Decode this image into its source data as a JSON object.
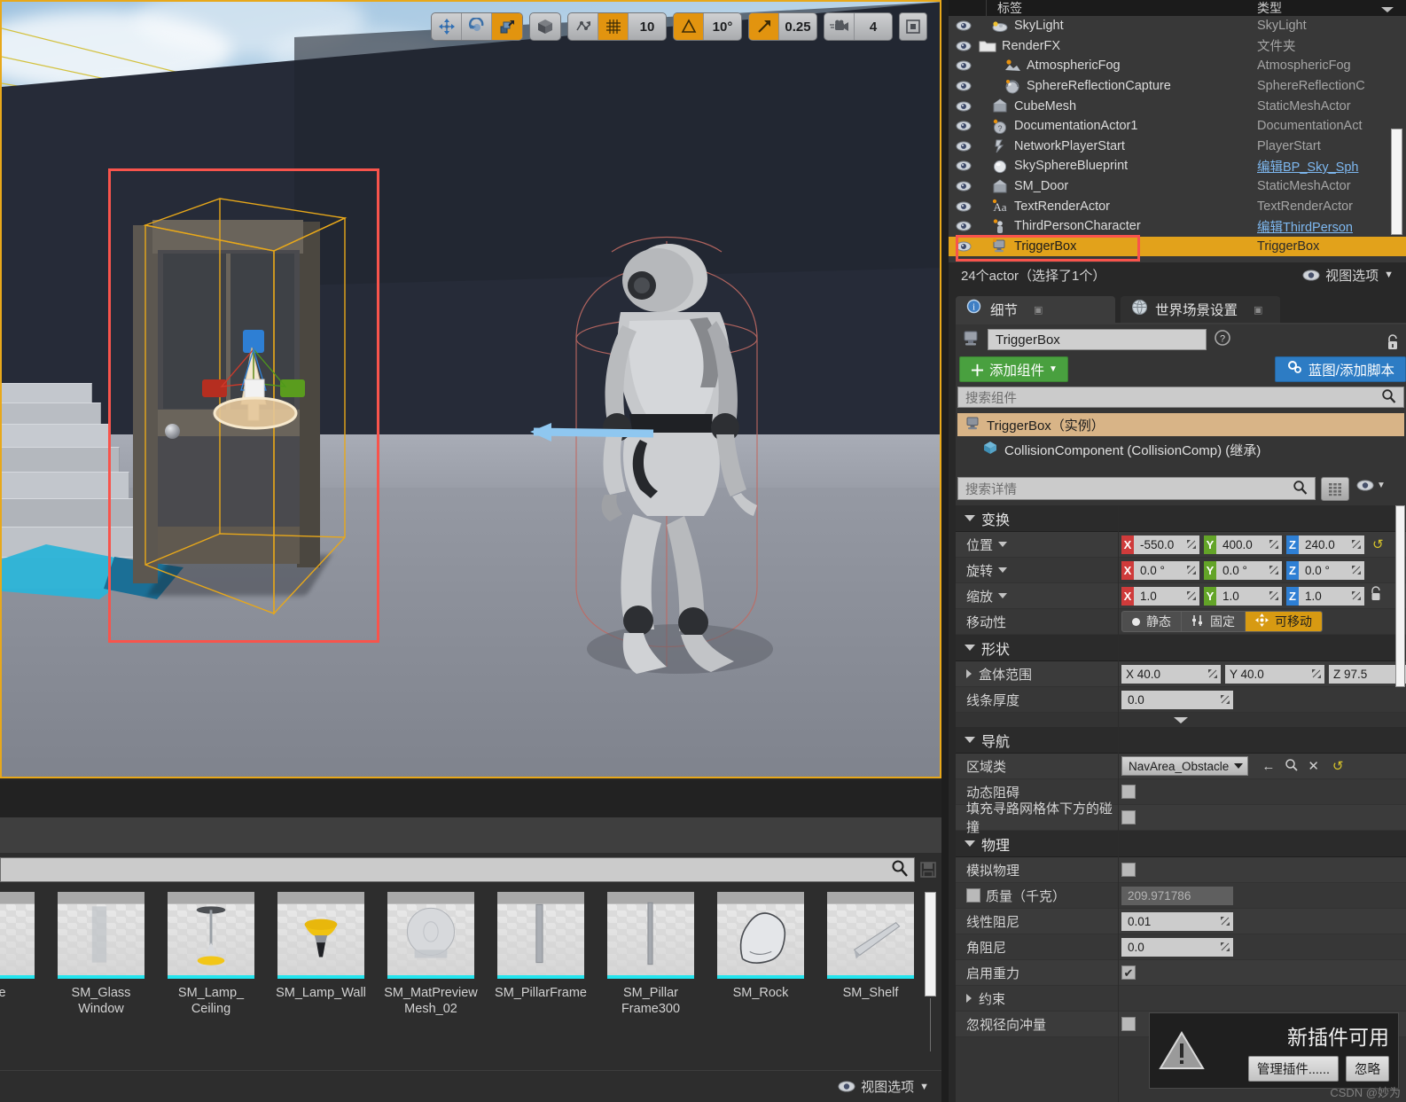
{
  "viewport": {
    "toolbar": {
      "transform_modes": [
        {
          "name": "translate-mode",
          "active": false
        },
        {
          "name": "rotate-mode",
          "active": false
        },
        {
          "name": "scale-mode",
          "active": true
        }
      ],
      "coord_space": {
        "name": "world-space-toggle",
        "active": false
      },
      "surface_snap": {
        "name": "surface-snap-toggle",
        "active": false
      },
      "grid_snap": {
        "name": "grid-snap-toggle",
        "active": true,
        "value": "10"
      },
      "angle_snap": {
        "name": "angle-snap-toggle",
        "active": true,
        "value": "10°"
      },
      "scale_snap": {
        "name": "scale-snap-toggle",
        "active": true,
        "value": "0.25"
      },
      "camera_speed": {
        "name": "camera-speed",
        "value": "4"
      },
      "maximize": {
        "name": "maximize-viewport-button"
      }
    }
  },
  "outliner": {
    "columns": {
      "label": "标签",
      "type": "类型"
    },
    "rows": [
      {
        "name": "SkyLight",
        "type": "SkyLight",
        "indent": 1,
        "icon": "skylight-icon",
        "blueprint": false,
        "selected": false
      },
      {
        "name": "RenderFX",
        "type": "文件夹",
        "indent": 0,
        "icon": "folder-icon",
        "blueprint": false,
        "selected": false
      },
      {
        "name": "AtmosphericFog",
        "type": "AtmosphericFog",
        "indent": 2,
        "icon": "fog-icon",
        "blueprint": false,
        "selected": false
      },
      {
        "name": "SphereReflectionCapture",
        "type": "SphereReflectionC",
        "indent": 2,
        "icon": "reflection-icon",
        "blueprint": false,
        "selected": false
      },
      {
        "name": "CubeMesh",
        "type": "StaticMeshActor",
        "indent": 1,
        "icon": "mesh-icon",
        "blueprint": false,
        "selected": false
      },
      {
        "name": "DocumentationActor1",
        "type": "DocumentationAct",
        "indent": 1,
        "icon": "doc-icon",
        "blueprint": false,
        "selected": false
      },
      {
        "name": "NetworkPlayerStart",
        "type": "PlayerStart",
        "indent": 1,
        "icon": "playerstart-icon",
        "blueprint": false,
        "selected": false
      },
      {
        "name": "SkySphereBlueprint",
        "type": "编辑BP_Sky_Sph",
        "indent": 1,
        "icon": "sphere-icon",
        "blueprint": true,
        "selected": false
      },
      {
        "name": "SM_Door",
        "type": "StaticMeshActor",
        "indent": 1,
        "icon": "mesh-icon",
        "blueprint": false,
        "selected": false
      },
      {
        "name": "TextRenderActor",
        "type": "TextRenderActor",
        "indent": 1,
        "icon": "text-icon",
        "blueprint": false,
        "selected": false
      },
      {
        "name": "ThirdPersonCharacter",
        "type": "编辑ThirdPerson",
        "indent": 1,
        "icon": "character-icon",
        "blueprint": true,
        "selected": false
      },
      {
        "name": "TriggerBox",
        "type": "TriggerBox",
        "indent": 1,
        "icon": "trigger-icon",
        "blueprint": false,
        "selected": true
      }
    ],
    "status": "24个actor（选择了1个）",
    "view_options": "视图选项"
  },
  "details": {
    "tabs": [
      {
        "label": "细节",
        "icon": "magnifier-icon",
        "active": true
      },
      {
        "label": "世界场景设置",
        "icon": "globe-icon",
        "active": false
      }
    ],
    "actor_name": "TriggerBox",
    "help_icon": "help-icon",
    "lock_icon": "unlock-icon",
    "add_component_label": "添加组件",
    "blueprint_label": "蓝图/添加脚本",
    "component_search_placeholder": "搜索组件",
    "components": [
      {
        "label": "TriggerBox（实例）",
        "icon": "trigger-icon",
        "selected": true
      },
      {
        "label": "CollisionComponent (CollisionComp) (继承)",
        "icon": "cube-icon",
        "selected": false
      }
    ],
    "details_search_placeholder": "搜索详情",
    "sections": [
      {
        "title": "变换",
        "rows": [
          {
            "label": "位置",
            "kind": "vector",
            "dropdown": true,
            "x": "-550.0",
            "y": "400.0",
            "z": "240.0",
            "reset": true
          },
          {
            "label": "旋转",
            "kind": "vector",
            "dropdown": true,
            "x": "0.0 °",
            "y": "0.0 °",
            "z": "0.0 °",
            "reset": false
          },
          {
            "label": "缩放",
            "kind": "vector",
            "dropdown": true,
            "x": "1.0",
            "y": "1.0",
            "z": "1.0",
            "lock": true
          },
          {
            "label": "移动性",
            "kind": "mobility",
            "options": [
              {
                "label": "静态",
                "active": false
              },
              {
                "label": "固定",
                "active": false
              },
              {
                "label": "可移动",
                "active": true
              }
            ]
          }
        ]
      },
      {
        "title": "形状",
        "rows": [
          {
            "label": "盒体范围",
            "kind": "vector_plain",
            "expand": true,
            "x": "X  40.0",
            "y": "Y  40.0",
            "z": "Z  97.5",
            "reset": true
          },
          {
            "label": "线条厚度",
            "kind": "number",
            "value": "0.0"
          }
        ]
      },
      {
        "title": "导航",
        "rows": [
          {
            "label": "区域类",
            "kind": "combo",
            "value": "NavArea_Obstacle",
            "icons": [
              "back-arrow-icon",
              "browse-icon",
              "clear-icon",
              "reset-icon"
            ]
          },
          {
            "label": "动态阻碍",
            "kind": "checkbox",
            "checked": false
          },
          {
            "label": "填充寻路网格体下方的碰撞",
            "kind": "checkbox",
            "checked": false
          }
        ]
      },
      {
        "title": "物理",
        "rows": [
          {
            "label": "模拟物理",
            "kind": "checkbox",
            "checked": false
          },
          {
            "label": "质量（千克）",
            "kind": "checkbox_value",
            "checked": false,
            "value": "209.971786",
            "disabled": true
          },
          {
            "label": "线性阻尼",
            "kind": "number",
            "value": "0.01"
          },
          {
            "label": "角阻尼",
            "kind": "number",
            "value": "0.0"
          },
          {
            "label": "启用重力",
            "kind": "checkbox",
            "checked": true
          },
          {
            "label": "约束",
            "kind": "expand"
          },
          {
            "label": "忽视径向冲量",
            "kind": "checkbox",
            "checked": false
          }
        ]
      }
    ]
  },
  "content_browser": {
    "search_placeholder": "",
    "search_icon": "magnifier-icon",
    "save_icon": "save-icon",
    "items": [
      {
        "label": "rame",
        "thumb": "partial",
        "partial": true
      },
      {
        "label": "SM_Glass Window",
        "thumb": "glass-window"
      },
      {
        "label": "SM_Lamp_ Ceiling",
        "thumb": "lamp-ceiling"
      },
      {
        "label": "SM_Lamp_Wall",
        "thumb": "lamp-wall"
      },
      {
        "label": "SM_MatPreview Mesh_02",
        "thumb": "matpreview-sphere"
      },
      {
        "label": "SM_PillarFrame",
        "thumb": "pillar"
      },
      {
        "label": "SM_Pillar Frame300",
        "thumb": "pillar300"
      },
      {
        "label": "SM_Rock",
        "thumb": "rock"
      },
      {
        "label": "SM_Shelf",
        "thumb": "shelf"
      }
    ],
    "view_options": "视图选项"
  },
  "notification": {
    "icon": "warning-icon",
    "title": "新插件可用",
    "buttons": [
      {
        "label": "管理插件......",
        "name": "manage-plugins-button"
      },
      {
        "label": "忽略",
        "name": "dismiss-button"
      }
    ]
  },
  "watermark": "CSDN @妙为"
}
